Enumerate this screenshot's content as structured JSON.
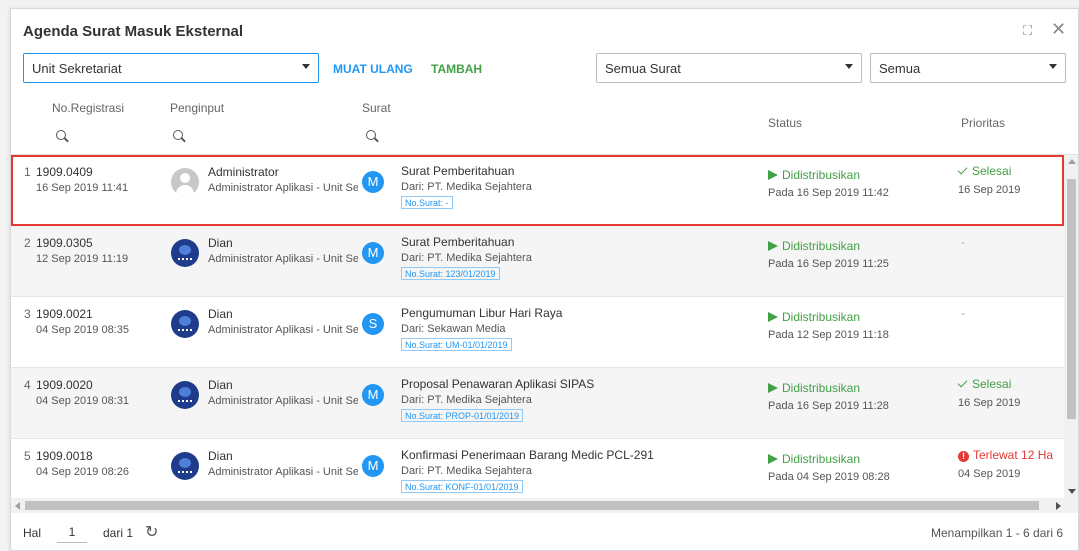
{
  "window": {
    "title": "Agenda Surat Masuk Eksternal"
  },
  "toolbar": {
    "unit_select": "Unit Sekretariat",
    "reload_label": "MUAT ULANG",
    "add_label": "TAMBAH",
    "letter_filter": "Semua Surat",
    "status_filter": "Semua"
  },
  "columns": {
    "registration": "No.Registrasi",
    "inputter": "Penginput",
    "letter": "Surat",
    "status": "Status",
    "priority": "Prioritas"
  },
  "rows": [
    {
      "index": "1",
      "reg_no": "1909.0409",
      "reg_date": "16 Sep 2019 11:41",
      "inputter_name": "Administrator",
      "inputter_role": "Administrator Aplikasi - Unit Se",
      "avatar": "user-placeholder-icon",
      "letter_badge": "M",
      "letter_title": "Surat Pemberitahuan",
      "letter_from": "Dari: PT. Medika Sejahtera",
      "letter_no": "No.Surat: -",
      "status": "Didistribusikan",
      "status_date": "Pada 16 Sep 2019 11:42",
      "priority": "Selesai",
      "priority_date": "16 Sep 2019",
      "priority_type": "done"
    },
    {
      "index": "2",
      "reg_no": "1909.0305",
      "reg_date": "12 Sep 2019 11:19",
      "inputter_name": "Dian",
      "inputter_role": "Administrator Aplikasi - Unit Se",
      "avatar": "org-logo-icon",
      "letter_badge": "M",
      "letter_title": "Surat Pemberitahuan",
      "letter_from": "Dari: PT. Medika Sejahtera",
      "letter_no": "No.Surat: 123/01/2019",
      "status": "Didistribusikan",
      "status_date": "Pada 16 Sep 2019 11:25",
      "priority": "-",
      "priority_date": "",
      "priority_type": "none"
    },
    {
      "index": "3",
      "reg_no": "1909.0021",
      "reg_date": "04 Sep 2019 08:35",
      "inputter_name": "Dian",
      "inputter_role": "Administrator Aplikasi - Unit Se",
      "avatar": "org-logo-icon",
      "letter_badge": "S",
      "letter_title": "Pengumuman Libur Hari Raya",
      "letter_from": "Dari: Sekawan Media",
      "letter_no": "No.Surat: UM-01/01/2019",
      "status": "Didistribusikan",
      "status_date": "Pada 12 Sep 2019 11:18",
      "priority": "-",
      "priority_date": "",
      "priority_type": "none"
    },
    {
      "index": "4",
      "reg_no": "1909.0020",
      "reg_date": "04 Sep 2019 08:31",
      "inputter_name": "Dian",
      "inputter_role": "Administrator Aplikasi - Unit Se",
      "avatar": "org-logo-icon",
      "letter_badge": "M",
      "letter_title": "Proposal Penawaran Aplikasi SIPAS",
      "letter_from": "Dari: PT. Medika Sejahtera",
      "letter_no": "No.Surat: PROP-01/01/2019",
      "status": "Didistribusikan",
      "status_date": "Pada 16 Sep 2019 11:28",
      "priority": "Selesai",
      "priority_date": "16 Sep 2019",
      "priority_type": "done"
    },
    {
      "index": "5",
      "reg_no": "1909.0018",
      "reg_date": "04 Sep 2019 08:26",
      "inputter_name": "Dian",
      "inputter_role": "Administrator Aplikasi - Unit Se",
      "avatar": "org-logo-icon",
      "letter_badge": "M",
      "letter_title": "Konfirmasi Penerimaan Barang Medic PCL-291",
      "letter_from": "Dari: PT. Medika Sejahtera",
      "letter_no": "No.Surat: KONF-01/01/2019",
      "status": "Didistribusikan",
      "status_date": "Pada 04 Sep 2019 08:28",
      "priority": "Terlewat 12 Ha",
      "priority_date": "04 Sep 2019",
      "priority_type": "late"
    }
  ],
  "footer": {
    "page_label": "Hal",
    "page_value": "1",
    "page_total": "dari 1",
    "summary": "Menampilkan 1 - 6 dari 6"
  },
  "colors": {
    "accent": "#2196f3",
    "green": "#43a047",
    "red": "#e53935",
    "selected_border": "#e53935"
  }
}
